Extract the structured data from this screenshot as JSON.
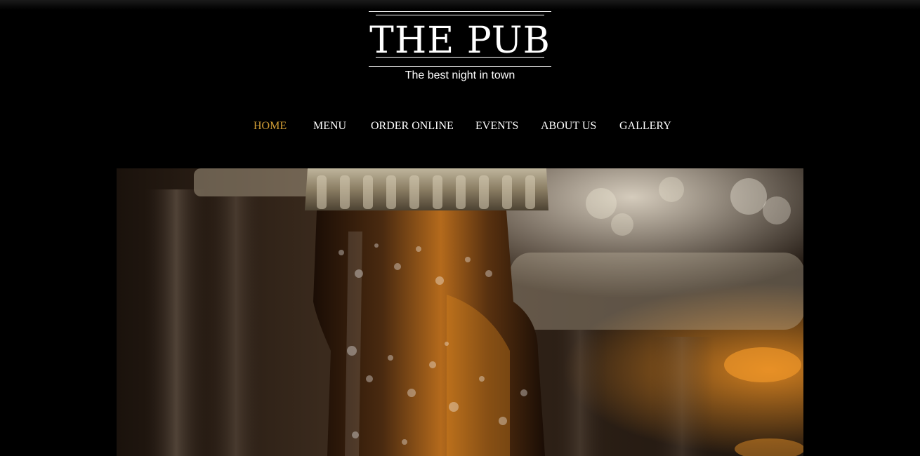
{
  "site": {
    "title": "THE PUB",
    "tagline": "The best night in town"
  },
  "nav": {
    "items": [
      {
        "label": "HOME",
        "active": true
      },
      {
        "label": "MENU",
        "active": false
      },
      {
        "label": "ORDER ONLINE",
        "active": false
      },
      {
        "label": "EVENTS",
        "active": false
      },
      {
        "label": "ABOUT US",
        "active": false
      },
      {
        "label": "GALLERY",
        "active": false
      }
    ],
    "active_color": "#d19d35",
    "text_color": "#ffffff"
  },
  "hero": {
    "subject": "close-up of chilled beer bottle with cap and water droplets"
  },
  "colors": {
    "background": "#000000",
    "amber": "#c8731c"
  }
}
